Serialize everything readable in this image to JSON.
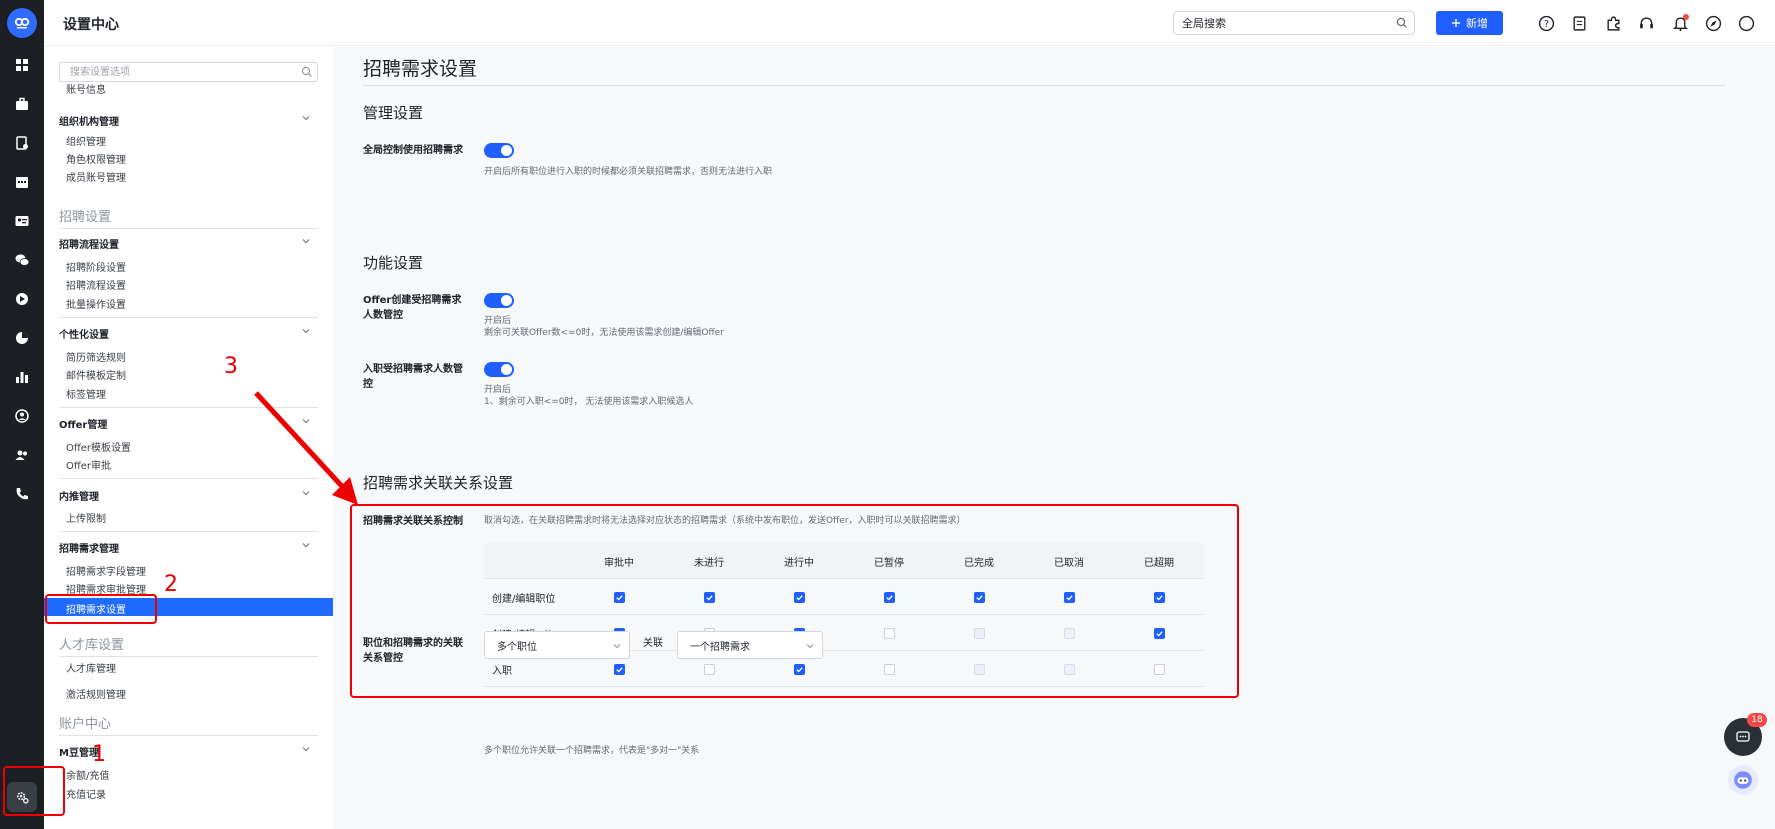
{
  "app": {
    "title": "设置中心",
    "global_search_placeholder": "全局搜索",
    "new_button_label": "新增",
    "notification_badge": "18"
  },
  "sidebar": {
    "search_placeholder": "搜索设置选项",
    "account_info": "账号信息",
    "org_group": {
      "label": "组织机构管理",
      "items": [
        "组织管理",
        "角色权限管理",
        "成员账号管理"
      ]
    },
    "recruit_section": "招聘设置",
    "flow_group": {
      "label": "招聘流程设置",
      "items": [
        "招聘阶段设置",
        "招聘流程设置",
        "批量操作设置"
      ]
    },
    "personal_group": {
      "label": "个性化设置",
      "items": [
        "简历筛选规则",
        "邮件模板定制",
        "标签管理"
      ]
    },
    "offer_group": {
      "label": "Offer管理",
      "items": [
        "Offer模板设置",
        "Offer审批"
      ]
    },
    "referral_group": {
      "label": "内推管理",
      "items": [
        "上传限制"
      ]
    },
    "demand_group": {
      "label": "招聘需求管理",
      "items": [
        "招聘需求字段管理",
        "招聘需求审批管理",
        "招聘需求设置"
      ]
    },
    "talent_section": "人才库设置",
    "talent_items": [
      "人才库管理",
      "激活规则管理"
    ],
    "account_section": "账户中心",
    "mdou_group": {
      "label": "M豆管理",
      "items": [
        "余额/充值",
        "充值记录"
      ]
    }
  },
  "main": {
    "page_title": "招聘需求设置",
    "manage": {
      "heading": "管理设置",
      "global_label": "全局控制使用招聘需求",
      "global_desc": "开启后所有职位进行入职的时候都必须关联招聘需求，否则无法进行入职",
      "global_on": true
    },
    "func": {
      "heading": "功能设置",
      "offer_label": "Offer创建受招聘需求人数管控",
      "offer_desc1": "开启后",
      "offer_desc2": "剩余可关联Offer数<=0时，无法使用该需求创建/编辑Offer",
      "offer_on": true,
      "entry_label": "入职受招聘需求人数管控",
      "entry_desc1": "开启后",
      "entry_desc2": "1、剩余可入职<=0时， 无法使用该需求入职候选人",
      "entry_on": true
    },
    "relation": {
      "heading": "招聘需求关联关系设置",
      "control_label": "招聘需求关联关系控制",
      "control_desc": "取消勾选，在关联招聘需求时将无法选择对应状态的招聘需求（系统中发布职位，发送Offer，入职时可以关联招聘需求）",
      "columns": [
        "审批中",
        "未进行",
        "进行中",
        "已暂停",
        "已完成",
        "已取消",
        "已超期"
      ],
      "rows": [
        {
          "label": "创建/编辑职位",
          "states": [
            "on",
            "on",
            "on",
            "on",
            "on",
            "on",
            "on"
          ]
        },
        {
          "label": "创建/编辑Offer",
          "states": [
            "on",
            "off",
            "on",
            "off",
            "dis",
            "dis",
            "on"
          ]
        },
        {
          "label": "入职",
          "states": [
            "on",
            "off",
            "on",
            "off",
            "dis",
            "dis",
            "off"
          ]
        }
      ],
      "mapping_label": "职位和招聘需求的关联关系管控",
      "select_left": "多个职位",
      "connector": "关联",
      "select_right": "一个招聘需求",
      "mapping_desc": "多个职位允许关联一个招聘需求，代表是\"多对一\"关系"
    }
  },
  "annotations": {
    "n1": "1",
    "n2": "2",
    "n3": "3",
    "color": "#ee0000"
  },
  "colors": {
    "accent": "#1f5eff",
    "rail_bg": "#1c1f23",
    "active_item": "#1f6bff"
  }
}
